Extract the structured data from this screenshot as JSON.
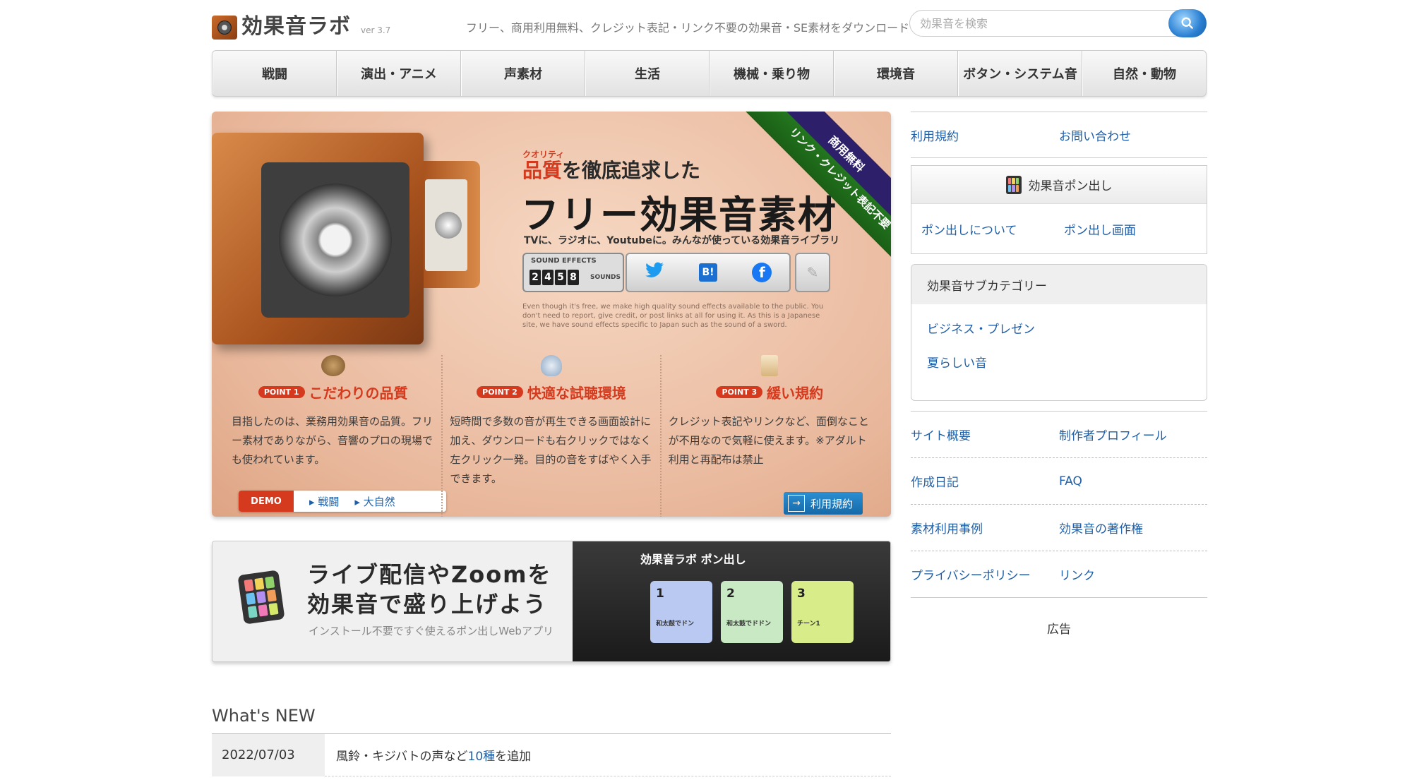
{
  "header": {
    "logo_text": "効果音ラボ",
    "version": "ver 3.7",
    "tagline": "フリー、商用利用無料、クレジット表記・リンク不要の効果音・SE素材をダウンロード",
    "search_placeholder": "効果音を検索"
  },
  "nav": {
    "items": [
      "戦闘",
      "演出・アニメ",
      "声素材",
      "生活",
      "機械・乗り物",
      "環境音",
      "ボタン・システム音",
      "自然・動物"
    ]
  },
  "hero": {
    "ruby": "クオリティ",
    "line1_red": "品質",
    "line1_rest": "を徹底追求した",
    "title": "フリー効果音素材",
    "subtitle": "TVに、ラジオに、Youtubeに。みんなが使っている効果音ライブラリ",
    "sfx_label": "SOUND EFFECTS",
    "sfx_digits": [
      "2",
      "4",
      "5",
      "8"
    ],
    "sfx_unit": "SOUNDS",
    "share": {
      "twitter": "twitter-icon",
      "hatena": "B!",
      "facebook": "f"
    },
    "english": "Even though it's free, we make high quality sound effects available to the public. You don't need to report, give credit, or post links at all for using it. As this is a Japanese site, we have sound effects specific to Japan such as the sound of a sword.",
    "ribbon_top": "商用無料",
    "ribbon_bottom": "リンク・クレジット表記不要",
    "points": [
      {
        "badge": "POINT 1",
        "title": "こだわりの品質",
        "text": "目指したのは、業務用効果音の品質。フリー素材でありながら、音響のプロの現場でも使われています。"
      },
      {
        "badge": "POINT 2",
        "title": "快適な試聴環境",
        "text": "短時間で多数の音が再生できる画面設計に加え、ダウンロードも右クリックではなく左クリック一発。目的の音をすばやく入手できます。"
      },
      {
        "badge": "POINT 3",
        "title": "緩い規約",
        "text": "クレジット表記やリンクなど、面倒なことが不用なので気軽に使えます。※アダルト利用と再配布は禁止"
      }
    ],
    "demo_label": "DEMO",
    "demo_links": [
      "戦闘",
      "大自然"
    ],
    "terms_button": "利用規約"
  },
  "banner2": {
    "title_line1": "ライブ配信やZoomを",
    "title_line2": "効果音で盛り上げよう",
    "subtitle": "インストール不要ですぐ使えるポン出しWebアプリ",
    "right_title": "効果音ラボ ポン出し",
    "pads": [
      {
        "num": "1",
        "label": "和太鼓でドン",
        "color": "#b9c9f2"
      },
      {
        "num": "2",
        "label": "和太鼓でドドン",
        "color": "#c9e8c4"
      },
      {
        "num": "3",
        "label": "チーン1",
        "color": "#d8ec8a"
      }
    ]
  },
  "news": {
    "heading": "What's NEW",
    "items": [
      {
        "date": "2022/07/03",
        "text_before": "風鈴・キジバトの声など",
        "link": "10種",
        "text_after": "を追加"
      }
    ]
  },
  "sidebar": {
    "top_links": [
      "利用規約",
      "お問い合わせ"
    ],
    "pon_title": "効果音ポン出し",
    "pon_links": [
      "ポン出しについて",
      "ポン出し画面"
    ],
    "subcat_title": "効果音サブカテゴリー",
    "subcat_links": [
      "ビジネス・プレゼン",
      "夏らしい音"
    ],
    "links": [
      [
        "サイト概要",
        "制作者プロフィール"
      ],
      [
        "作成日記",
        "FAQ"
      ],
      [
        "素材利用事例",
        "効果音の著作権"
      ],
      [
        "プライバシーポリシー",
        "リンク"
      ]
    ],
    "ad_label": "広告"
  },
  "colors": {
    "accent_red": "#d63a1e",
    "link_blue": "#1f5fa8",
    "ribbon_green": "#2b8a26",
    "ribbon_purple": "#2e1f6b"
  }
}
